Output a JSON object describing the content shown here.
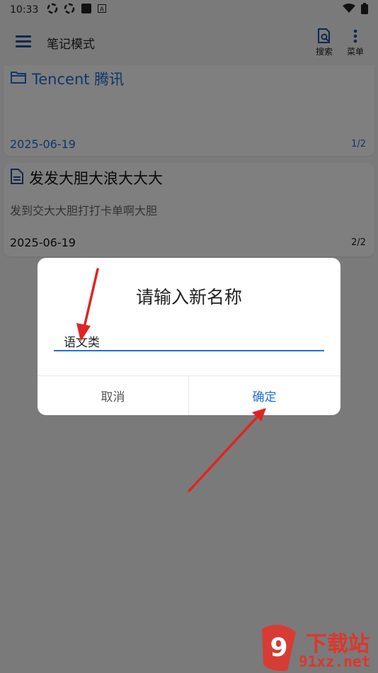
{
  "status_bar": {
    "time": "10:33",
    "icons": [
      "sync-icon",
      "sync-icon",
      "app-square-icon",
      "a-badge-icon",
      "wifi-icon",
      "battery-icon"
    ]
  },
  "app_bar": {
    "title": "笔记模式",
    "search_label": "搜索",
    "menu_label": "菜单"
  },
  "notes": [
    {
      "type": "folder",
      "icon": "folder-icon",
      "title": "Tencent 腾讯",
      "date": "2025-06-19",
      "page": "1/2"
    },
    {
      "type": "note",
      "icon": "document-icon",
      "title": "发发大胆大浪大大大",
      "preview": "发到交大大胆打打卡单啊大胆",
      "date": "2025-06-19",
      "page": "2/2"
    }
  ],
  "dialog": {
    "title": "请输入新名称",
    "input_value": "语文类",
    "cancel_label": "取消",
    "ok_label": "确定"
  },
  "colors": {
    "accent": "#1f6fd6",
    "arrow": "#e02424",
    "scrim": "rgba(0,0,0,0.5)"
  },
  "watermark": {
    "logo_text": "9",
    "brand": "下载站",
    "url": "91xz.net"
  }
}
